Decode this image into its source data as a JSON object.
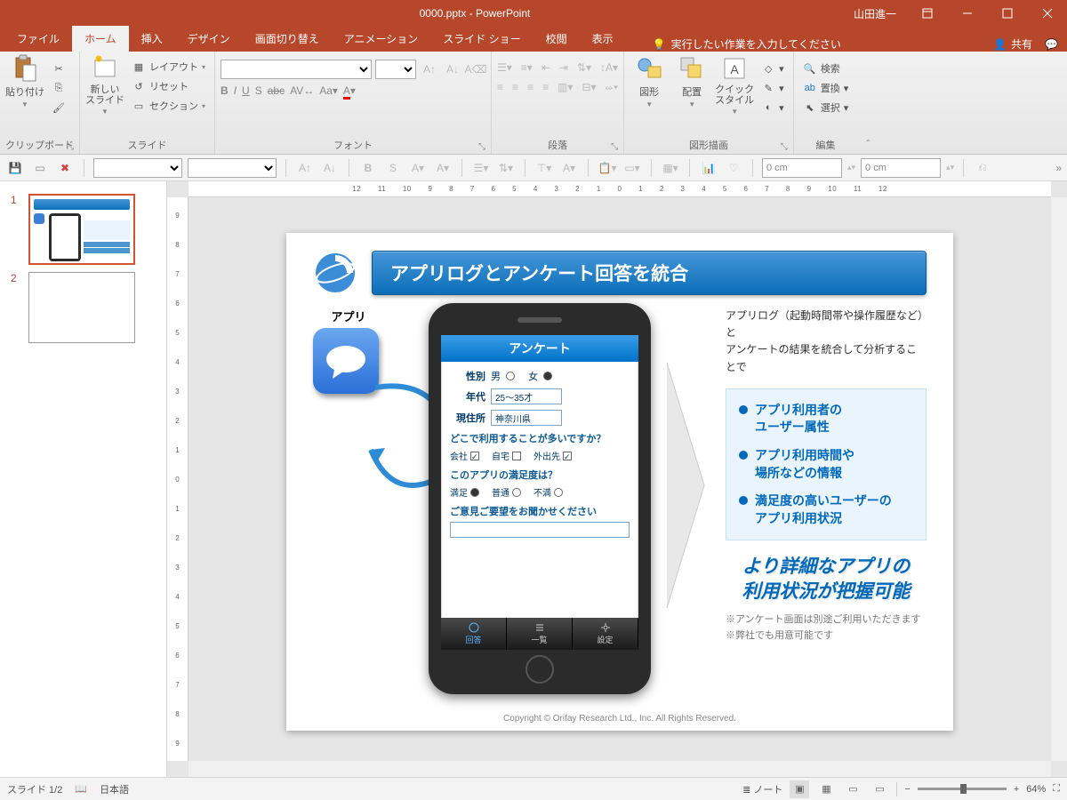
{
  "titlebar": {
    "title": "0000.pptx - PowerPoint",
    "user": "山田進一"
  },
  "tabs": {
    "file": "ファイル",
    "home": "ホーム",
    "insert": "挿入",
    "design": "デザイン",
    "transitions": "画面切り替え",
    "animations": "アニメーション",
    "slideshow": "スライド ショー",
    "review": "校閲",
    "view": "表示"
  },
  "tell_me": "実行したい作業を入力してください",
  "share": "共有",
  "ribbon": {
    "clipboard": {
      "label": "クリップボード",
      "paste": "貼り付け"
    },
    "slides": {
      "label": "スライド",
      "new_slide": "新しい\nスライド",
      "layout": "レイアウト",
      "reset": "リセット",
      "section": "セクション"
    },
    "font": {
      "label": "フォント"
    },
    "paragraph": {
      "label": "段落"
    },
    "drawing": {
      "label": "図形描画",
      "shapes": "図形",
      "arrange": "配置",
      "quick_styles": "クイック\nスタイル"
    },
    "editing": {
      "label": "編集",
      "find": "検索",
      "replace": "置換",
      "select": "選択"
    }
  },
  "secondary": {
    "dim1": "0 cm",
    "dim2": "0 cm"
  },
  "ruler_h": "12  11  10  9  8  7  6  5  4  3  2  1  0  1  2  3  4  5  6  7  8  9  10  11  12",
  "thumbnails": [
    {
      "num": "1"
    },
    {
      "num": "2"
    }
  ],
  "slide": {
    "title": "アプリログとアンケート回答を統合",
    "app_label": "アプリ",
    "survey_title": "アンケート",
    "gender_label": "性別",
    "gender_m": "男",
    "gender_f": "女",
    "age_label": "年代",
    "age_value": "25～35才",
    "addr_label": "現住所",
    "addr_value": "神奈川県",
    "q1": "どこで利用することが多いですか？",
    "q1_a": "会社",
    "q1_b": "自宅",
    "q1_c": "外出先",
    "q2": "このアプリの満足度は？",
    "q2_a": "満足",
    "q2_b": "普通",
    "q2_c": "不満",
    "q3": "ご意見ご要望をお聞かせください",
    "tab1": "回答",
    "tab2": "一覧",
    "tab3": "設定",
    "intro1": "アプリログ（起動時間帯や操作履歴など）と",
    "intro2": "アンケートの結果を統合して分析することで",
    "b1a": "アプリ利用者の",
    "b1b": "ユーザー属性",
    "b2a": "アプリ利用時間や",
    "b2b": "場所などの情報",
    "b3a": "満足度の高いユーザーの",
    "b3b": "アプリ利用状況",
    "conclusion1": "より詳細なアプリの",
    "conclusion2": "利用状況が把握可能",
    "note1": "※アンケート画面は別途ご利用いただきます",
    "note2": "※弊社でも用意可能です",
    "copyright": "Copyright ©  Orifay Research Ltd., Inc. All Rights Reserved."
  },
  "statusbar": {
    "slide_indicator": "スライド 1/2",
    "lang": "日本語",
    "notes": "ノート",
    "zoom": "64%"
  }
}
